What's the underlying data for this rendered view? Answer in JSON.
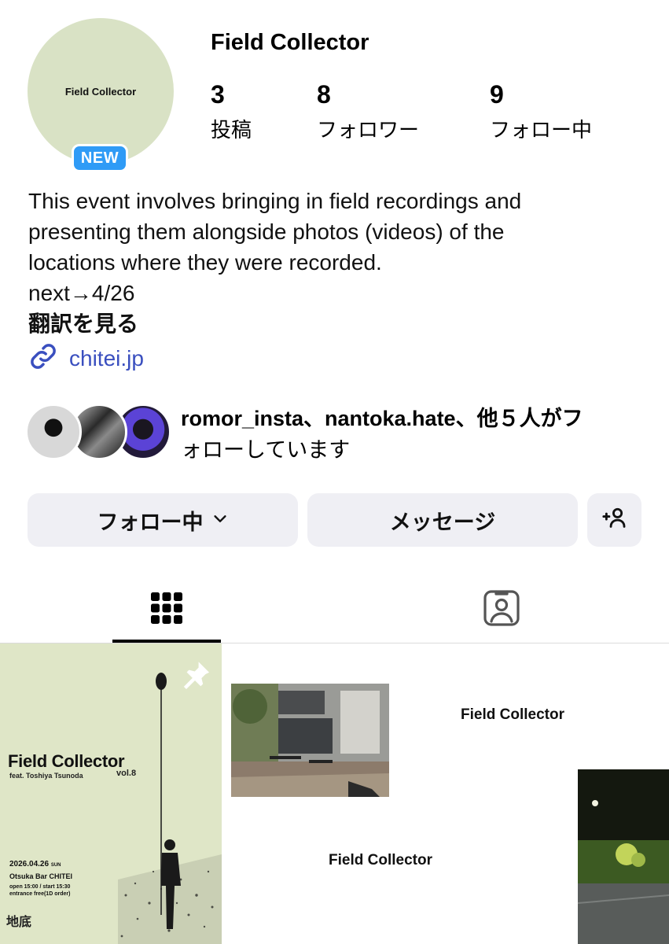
{
  "profile": {
    "name": "Field Collector",
    "avatar_label": "Field Collector",
    "new_badge": "NEW"
  },
  "stats": [
    {
      "number": "3",
      "label": "投稿"
    },
    {
      "number": "8",
      "label": "フォロワー"
    },
    {
      "number": "9",
      "label": "フォロー中"
    }
  ],
  "bio": {
    "lines": [
      "This event involves bringing in field recordings and",
      "presenting them alongside photos (videos) of the",
      "locations where they were recorded.",
      "next→4/26"
    ],
    "translate_label": "翻訳を見る",
    "link_text": "chitei.jp"
  },
  "followed_by": {
    "text_line1": "romor_insta、nantoka.hate、他５人がフ",
    "text_line2": "ォローしています"
  },
  "buttons": {
    "following_label": "フォロー中",
    "message_label": "メッセージ"
  },
  "posts": {
    "post1": {
      "title": "Field Collector",
      "feat": "feat. Toshiya Tsunoda",
      "vol": "vol.8",
      "date": "2026.04.26",
      "day": "SUN",
      "venue": "Otsuka Bar CHITEI",
      "times": "open 15:00 / start 15:30",
      "entry": "entrance free(1D order)",
      "mark": "地底"
    },
    "post2": {
      "caption": "Field Collector"
    },
    "post3": {
      "caption": "Field Collector"
    }
  },
  "icons": {
    "link": "link-icon",
    "chevron": "chevron-down-icon",
    "add_person": "add-person-icon",
    "grid": "grid-icon",
    "tagged": "tagged-person-icon",
    "pin": "pin-icon"
  },
  "colors": {
    "badge_blue": "#2f9bf6",
    "link_blue": "#3a4fbf",
    "button_bg": "#efeff4",
    "avatar_bg": "#d9e2c5"
  }
}
